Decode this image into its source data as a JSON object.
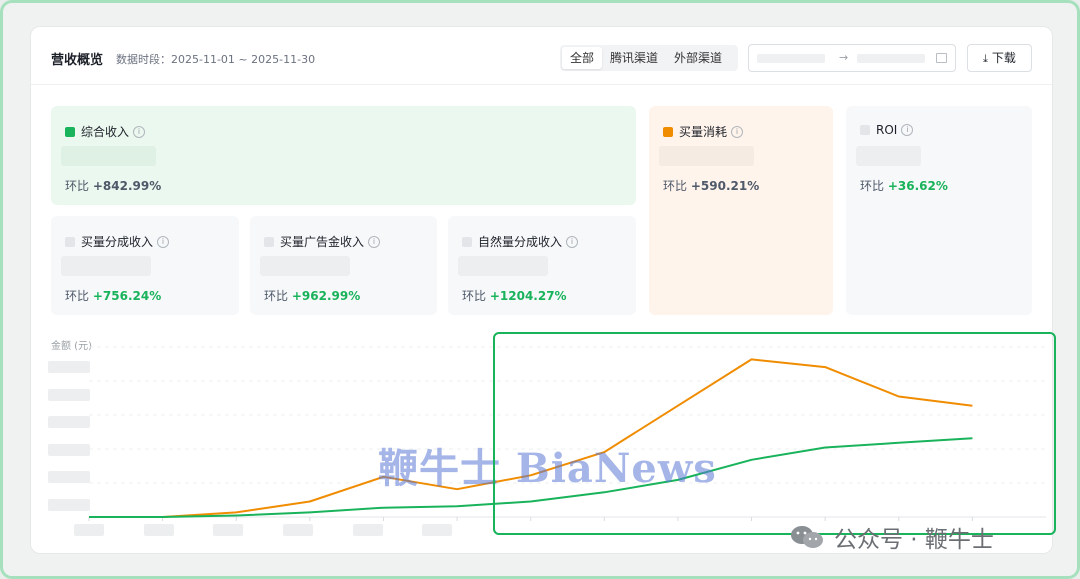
{
  "header": {
    "title": "营收概览",
    "period": "数据时段：2025-11-01 ~ 2025-11-30",
    "tabs": [
      "全部",
      "腾讯渠道",
      "外部渠道"
    ],
    "active_tab": "全部",
    "date_arrow": "→",
    "download_label": "下载"
  },
  "metrics": {
    "total_income": {
      "label": "综合收入",
      "mom_prefix": "环比",
      "mom": "+842.99%",
      "color": "#18b35a"
    },
    "buy_cost": {
      "label": "买量消耗",
      "mom_prefix": "环比",
      "mom": "+590.21%",
      "color": "#f08c00"
    },
    "roi": {
      "label": "ROI",
      "mom_prefix": "环比",
      "mom": "+36.62%"
    },
    "buy_share": {
      "label": "买量分成收入",
      "mom_prefix": "环比",
      "mom": "+756.24%"
    },
    "buy_ad_gold": {
      "label": "买量广告金收入",
      "mom_prefix": "环比",
      "mom": "+962.99%"
    },
    "natural_share": {
      "label": "自然量分成收入",
      "mom_prefix": "环比",
      "mom": "+1204.27%"
    }
  },
  "chart_data": {
    "type": "line",
    "ylabel": "金额 (元)",
    "x": [
      1,
      2,
      3,
      4,
      5,
      6,
      7,
      8,
      9,
      10,
      11,
      12,
      13,
      14
    ],
    "series": [
      {
        "color": "#f08c00",
        "values": [
          0,
          0,
          1.5,
          5,
          13,
          9,
          13.5,
          21,
          36,
          51,
          48.5,
          39,
          36
        ]
      },
      {
        "color": "#18b35a",
        "values": [
          0,
          0,
          0.5,
          1.5,
          3,
          3.5,
          5,
          8,
          12,
          18.5,
          22.5,
          24,
          25.5
        ]
      }
    ],
    "ylim": [
      0,
      55
    ],
    "grid": true
  },
  "overlay": {
    "watermark": "鞭牛士 BiaNews",
    "wechat_text": "公众号 · 鞭牛士",
    "highlight_color": "#18b35a"
  }
}
